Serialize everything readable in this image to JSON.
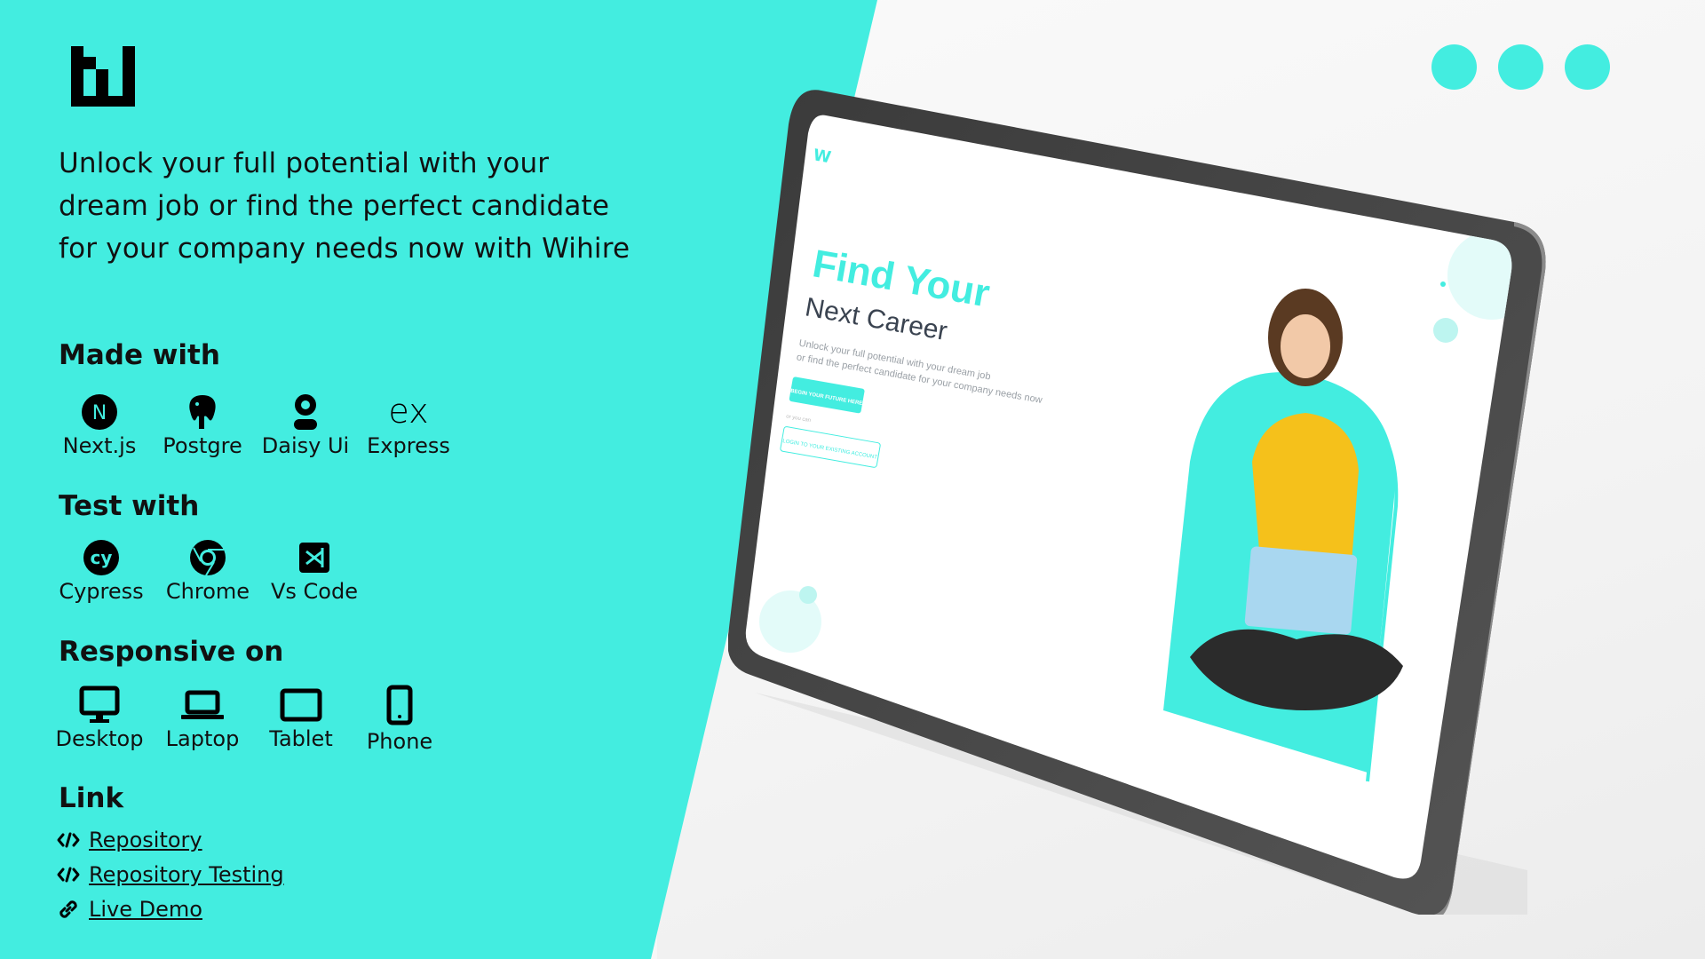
{
  "brand": {
    "name": "Wihire",
    "accent": "#43ede0"
  },
  "headline": "Unlock your full potential with your dream job or find the perfect candidate for your company needs now with Wihire",
  "made_with": {
    "title": "Made with",
    "items": [
      {
        "label": "Next.js",
        "icon": "nextjs-icon"
      },
      {
        "label": "Postgre",
        "icon": "postgres-icon"
      },
      {
        "label": "Daisy Ui",
        "icon": "daisyui-icon"
      },
      {
        "label": "Express",
        "icon": "express-icon"
      }
    ]
  },
  "test_with": {
    "title": "Test with",
    "items": [
      {
        "label": "Cypress",
        "icon": "cypress-icon"
      },
      {
        "label": "Chrome",
        "icon": "chrome-icon"
      },
      {
        "label": "Vs Code",
        "icon": "vscode-icon"
      }
    ]
  },
  "responsive_on": {
    "title": "Responsive on",
    "items": [
      {
        "label": "Desktop",
        "icon": "desktop-icon"
      },
      {
        "label": "Laptop",
        "icon": "laptop-icon"
      },
      {
        "label": "Tablet",
        "icon": "tablet-icon"
      },
      {
        "label": "Phone",
        "icon": "phone-icon"
      }
    ]
  },
  "link": {
    "title": "Link",
    "items": [
      {
        "label": "Repository",
        "icon": "code-icon"
      },
      {
        "label": "Repository Testing",
        "icon": "code-icon"
      },
      {
        "label": "Live Demo",
        "icon": "link-icon"
      }
    ]
  },
  "mockup": {
    "title_line1": "Find Your",
    "title_line2": "Next Career",
    "desc_line1": "Unlock your full potential with your dream job",
    "desc_line2": "or find the perfect candidate for your company needs now",
    "primary_button": "BEGIN YOUR FUTURE HERE",
    "or_text": "or you can",
    "secondary_button": "LOGIN TO YOUR EXISTING ACCOUNT"
  }
}
